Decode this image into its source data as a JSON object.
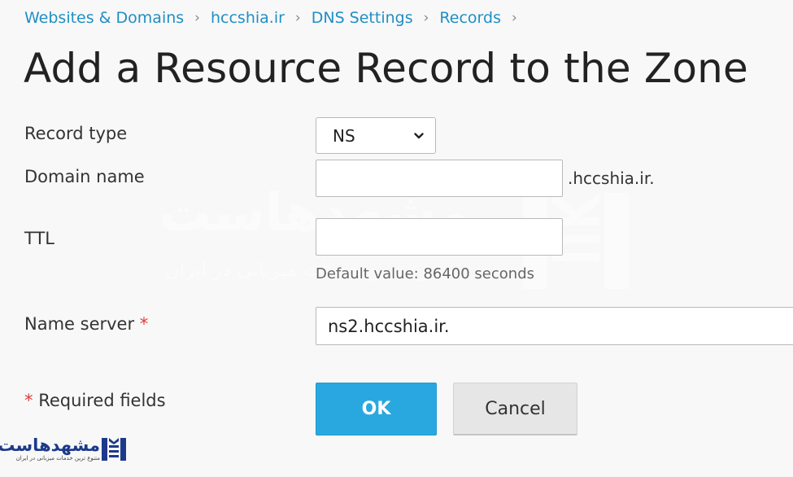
{
  "breadcrumb": {
    "items": [
      {
        "label": "Websites & Domains"
      },
      {
        "label": "hccshia.ir"
      },
      {
        "label": "DNS Settings"
      },
      {
        "label": "Records"
      }
    ],
    "separator": "›"
  },
  "page_title": "Add a Resource Record to the Zone",
  "form": {
    "record_type": {
      "label": "Record type",
      "value": "NS"
    },
    "domain_name": {
      "label": "Domain name",
      "value": "",
      "suffix": ".hccshia.ir."
    },
    "ttl": {
      "label": "TTL",
      "value": "",
      "hint": "Default value: 86400 seconds"
    },
    "name_server": {
      "label": "Name server",
      "required_mark": "*",
      "value": "ns2.hccshia.ir."
    },
    "required_note": {
      "star": "*",
      "text": "Required fields"
    }
  },
  "buttons": {
    "ok": "OK",
    "cancel": "Cancel"
  },
  "watermark": {
    "text": "مشهدهاست",
    "subtitle": "متنوع ترین خدمات میزبانی در ایران"
  },
  "logo": {
    "text": "مشهدهاست",
    "subtitle": "متنوع ترین خدمات میزبانی در ایران"
  },
  "colors": {
    "link": "#1f8fc5",
    "primary_button": "#29a8e0",
    "required_star": "#e03b3b",
    "logo_blue": "#1d3a8a"
  },
  "icons": {
    "select_arrow": "chevron-down-icon",
    "breadcrumb_separator": "chevron-right-icon"
  }
}
